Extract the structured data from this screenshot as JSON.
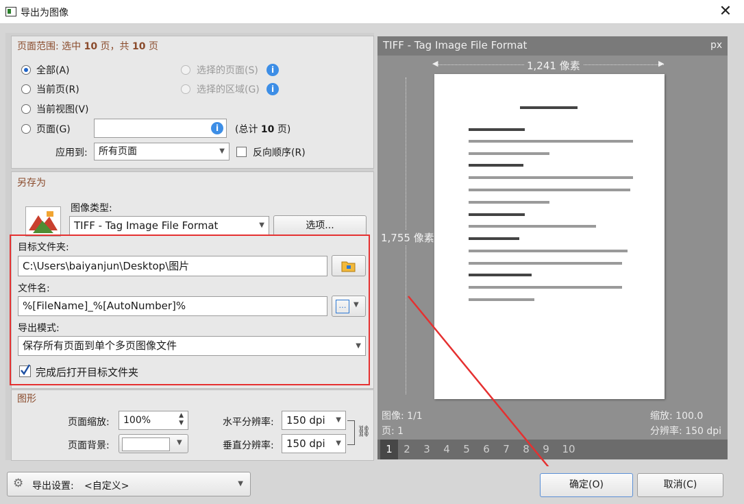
{
  "window": {
    "title": "导出为图像",
    "close": "✕"
  },
  "range": {
    "header_prefix": "页面范围: 选中 ",
    "header_sel": "10",
    "header_mid": " 页，共 ",
    "header_total": "10",
    "header_suffix": " 页",
    "opt_all": "全部(A)",
    "opt_current": "当前页(R)",
    "opt_view": "当前视图(V)",
    "opt_pages": "页面(G)",
    "opt_selected_pages": "选择的页面(S)",
    "opt_selected_area": "选择的区域(G)",
    "total_prefix": "(总计 ",
    "total_count": "10",
    "total_suffix": " 页)",
    "apply_label": "应用到:",
    "apply_value": "所有页面",
    "reverse_label": "反向顺序(R)"
  },
  "saveas": {
    "header": "另存为",
    "type_label": "图像类型:",
    "type_value": "TIFF - Tag Image File Format",
    "options_button": "选项...",
    "folder_label": "目标文件夹:",
    "folder_value": "C:\\Users\\baiyanjun\\Desktop\\图片",
    "filename_label": "文件名:",
    "filename_value": "%[FileName]_%[AutoNumber]%",
    "mode_label": "导出模式:",
    "mode_value": "保存所有页面到单个多页图像文件",
    "open_after": "完成后打开目标文件夹"
  },
  "graphics": {
    "header": "图形",
    "scale_label": "页面缩放:",
    "scale_value": "100%",
    "bg_label": "页面背景:",
    "hres_label": "水平分辨率:",
    "hres_value": "150 dpi",
    "vres_label": "垂直分辨率:",
    "vres_value": "150 dpi"
  },
  "preview": {
    "format": "TIFF - Tag Image File Format",
    "unit": "px",
    "width_label": "1,241 像素",
    "height_label": "1,755 像素",
    "image_info": "图像: 1/1",
    "page_info": "页: 1",
    "zoom_info": "缩放: 100.0",
    "dpi_info": "分辨率: 150 dpi",
    "pages": [
      "1",
      "2",
      "3",
      "4",
      "5",
      "6",
      "7",
      "8",
      "9",
      "10"
    ]
  },
  "footer": {
    "settings_label": "导出设置:",
    "settings_value": "<自定义>",
    "ok": "确定(O)",
    "cancel": "取消(C)"
  },
  "colors": {
    "accent": "#1f64c8",
    "highlight": "#e53030",
    "section_header": "#8a4b2c"
  },
  "icons": [
    "app-icon",
    "close-icon",
    "info-icon",
    "folder-icon",
    "macro-icon",
    "chain-link-icon",
    "gear-icon",
    "checkmark-icon",
    "image-type-icon"
  ]
}
